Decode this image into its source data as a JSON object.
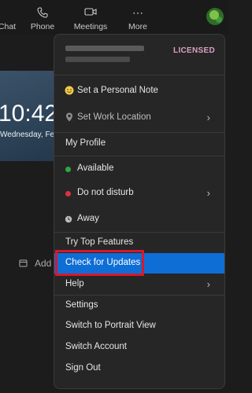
{
  "nav": {
    "chat": "Chat",
    "phone": "Phone",
    "meetings": "Meetings",
    "more": "More"
  },
  "background": {
    "time": "10:42",
    "date": "Wednesday, Fe",
    "add_label": "Add a"
  },
  "menu": {
    "license": "LICENSED",
    "items": [
      {
        "label": "Set a Personal Note"
      },
      {
        "label": "Set Work Location"
      },
      {
        "label": "My Profile"
      },
      {
        "label": "Available"
      },
      {
        "label": "Do not disturb"
      },
      {
        "label": "Away"
      },
      {
        "label": "Try Top Features"
      },
      {
        "label": "Check for Updates"
      },
      {
        "label": "Help"
      },
      {
        "label": "Settings"
      },
      {
        "label": "Switch to Portrait View"
      },
      {
        "label": "Switch Account"
      },
      {
        "label": "Sign Out"
      }
    ]
  },
  "colors": {
    "highlight": "#0e6ed6",
    "available": "#2ea843",
    "dnd": "#d9333f",
    "callout": "#d7182a"
  }
}
